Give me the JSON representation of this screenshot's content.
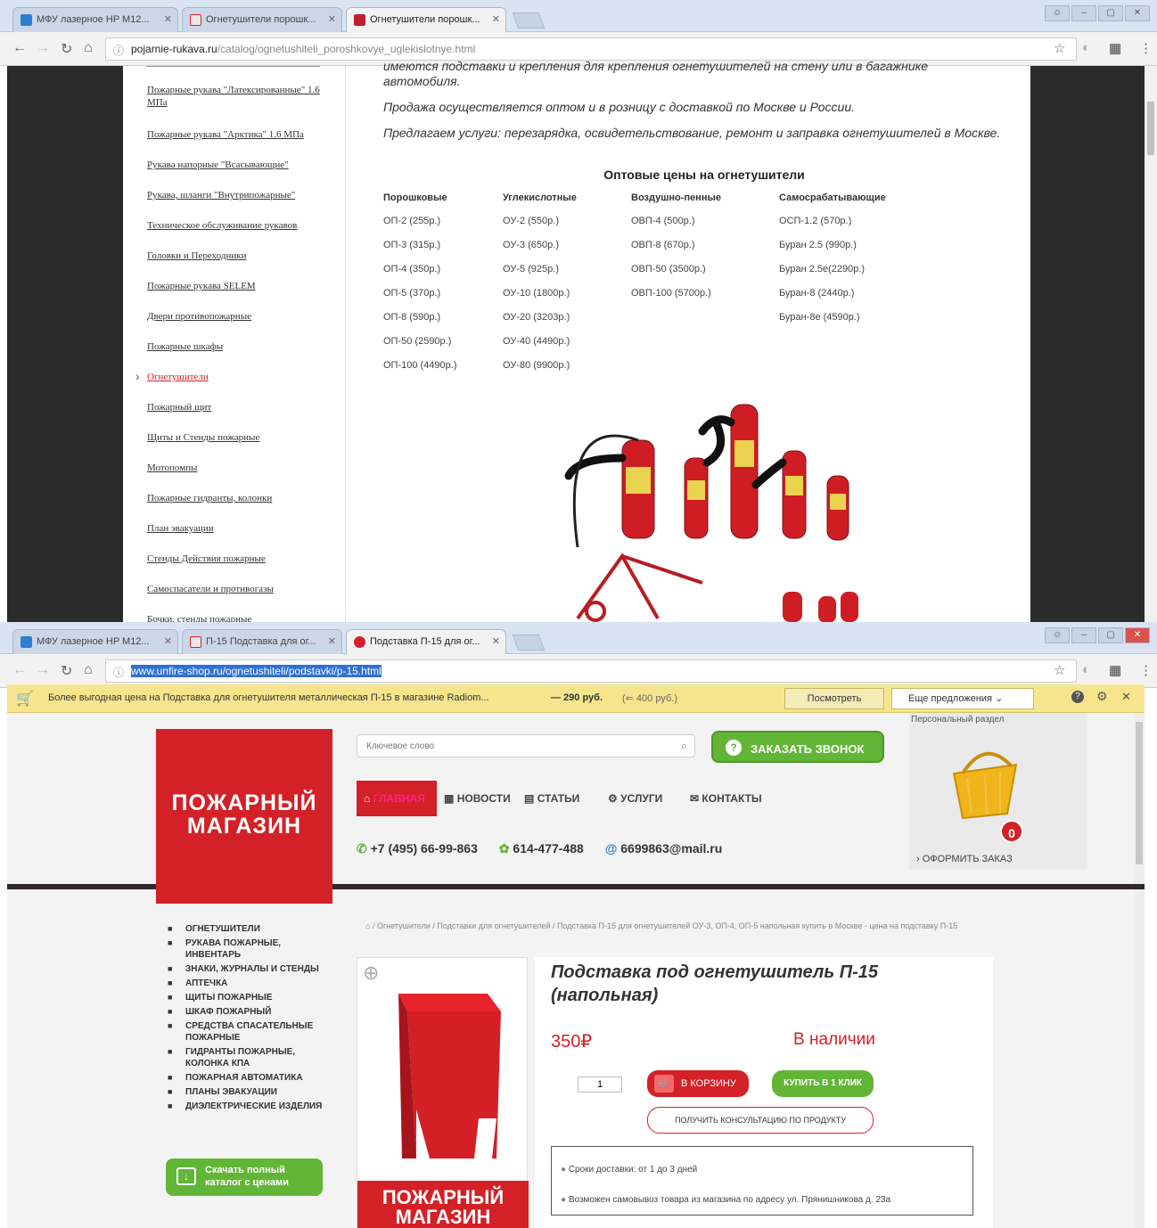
{
  "window1": {
    "tabs": [
      {
        "label": "МФУ лазерное HP M12..."
      },
      {
        "label": "Огнетушители порошк..."
      },
      {
        "label": "Огнетушители порошк..."
      }
    ],
    "url_host": "pojarnie-rukava.ru",
    "url_path": "/catalog/ognetushiteli_poroshkovye_uglekislotnye.html",
    "sidebar": [
      "Пожарные рукава \"Латексированные\" 1.6 МПа",
      "Пожарные рукава \"Арктика\" 1.6 МПа",
      "Рукава напорные \"Всасывающие\"",
      "Рукава, шланги \"Внутрипожарные\"",
      "Техническое обслуживание рукавов",
      "Головки и Переходники",
      "Пожарные рукава SELEM",
      "Двери противопожарные",
      "Пожарные шкафы",
      "Огнетушители",
      "Пожарный щит",
      "Щиты и Стенды пожарные",
      "Мотопомпы",
      "Пожарные гидранты, колонки",
      "План эвакуации",
      "Стенды Действия пожарные",
      "Самоспасатели и противогазы",
      "Бочки, стенды пожарные"
    ],
    "active_sidebar_index": 9,
    "text_top": "имеются подставки и крепления для крепления огнетушителей на стену или в багажнике автомобиля.",
    "text_sales": "Продажа осуществляется оптом и в розницу с доставкой по Москве и России.",
    "text_services": "Предлагаем услуги: перезарядка, освидетельствование, ремонт и заправка огнетушителей в Москве.",
    "prices_title": "Оптовые цены на огнетушители",
    "price_columns": [
      {
        "header": "Порошковые",
        "items": [
          "ОП-2 (255р.)",
          "ОП-3 (315р.)",
          "ОП-4 (350р.)",
          "ОП-5 (370р.)",
          "ОП-8 (590р.)",
          "ОП-50 (2590р.)",
          "ОП-100 (4490р.)"
        ]
      },
      {
        "header": "Углекислотные",
        "items": [
          "ОУ-2 (550р.)",
          "ОУ-3 (650р.)",
          "ОУ-5 (925р.)",
          "ОУ-10 (1800р.)",
          "ОУ-20 (3203р.)",
          "ОУ-40 (4490р.)",
          "ОУ-80 (9900р.)"
        ]
      },
      {
        "header": "Воздушно-пенные",
        "items": [
          "ОВП-4 (500р.)",
          "ОВП-8 (670р.)",
          "ОВП-50 (3500р.)",
          "ОВП-100 (5700р.)"
        ]
      },
      {
        "header": "Самосрабатывающие",
        "items": [
          "ОСП-1.2 (570р.)",
          "Буран 2.5 (990р.)",
          "Буран 2.5е(2290р.)",
          "Буран-8 (2440р.)",
          "Буран-8е (4590р.)"
        ]
      }
    ]
  },
  "window2": {
    "tabs": [
      {
        "label": "МФУ лазерное HP M12..."
      },
      {
        "label": "П-15 Подставка для ог..."
      },
      {
        "label": "Подставка П-15 для ог..."
      }
    ],
    "url": "www.unfire-shop.ru/ognetushiteli/podstavki/p-15.html",
    "infobar": {
      "text": "Более выгодная цена на Подставка для огнетушителя металлическая П-15 в магазине Radiom...",
      "price": "— 290 руб.",
      "old_price": "(⇐ 400 руб.)",
      "view_button": "Посмотреть",
      "more_button": "Еще предложения"
    },
    "logo_line1": "ПОЖАРНЫЙ",
    "logo_line2": "МАГАЗИН",
    "search_placeholder": "Ключевое слово",
    "call_button": "ЗАКАЗАТЬ ЗВОНОК",
    "nav": [
      "ГЛАВНАЯ",
      "НОВОСТИ",
      "СТАТЬИ",
      "УСЛУГИ",
      "КОНТАКТЫ"
    ],
    "phone": "+7 (495) 66-99-863",
    "icq": "614-477-488",
    "email": "6699863@mail.ru",
    "personal": "Персональный раздел",
    "cart_count": "0",
    "checkout": "› ОФОРМИТЬ ЗАКАЗ",
    "categories": [
      "ОГНЕТУШИТЕЛИ",
      "РУКАВА ПОЖАРНЫЕ, ИНВЕНТАРЬ",
      "ЗНАКИ, ЖУРНАЛЫ И СТЕНДЫ",
      "АПТЕЧКА",
      "ЩИТЫ ПОЖАРНЫЕ",
      "ШКАФ ПОЖАРНЫЙ",
      "СРЕДСТВА СПАСАТЕЛЬНЫЕ ПОЖАРНЫЕ",
      "ГИДРАНТЫ ПОЖАРНЫЕ, КОЛОНКА КПА",
      "ПОЖАРНАЯ АВТОМАТИКА",
      "ПЛАНЫ ЭВАКУАЦИИ",
      "ДИЭЛЕКТРИЧЕСКИЕ ИЗДЕЛИЯ"
    ],
    "catalog_button": "Скачать полный каталог с ценами",
    "breadcrumb": "/ Огнетушители / Подставки для огнетушителей / Подставка П-15 для огнетушителей ОУ-3, ОП-4, ОП-5 напольная купить в Москве - цена на подставку П-15",
    "product_title": "Подставка под огнетушитель П-15 (напольная)",
    "price": "350₽",
    "availability": "В наличии",
    "qty": "1",
    "to_cart": "В КОРЗИНУ",
    "buy_one_click": "КУПИТЬ В 1 КЛИК",
    "consult": "ПОЛУЧИТЬ КОНСУЛЬТАЦИЮ ПО ПРОДУКТУ",
    "info1": "Сроки доставки: от 1 до 3 дней",
    "info2": "Возможен самовывоз товара из магазина по адресу ул. Прянишникова д. 23а"
  },
  "colors": {
    "brand_red": "#d42027",
    "green": "#62b536",
    "infobar_yellow": "#f6e58d",
    "dark_bg": "#2b2b2b"
  }
}
